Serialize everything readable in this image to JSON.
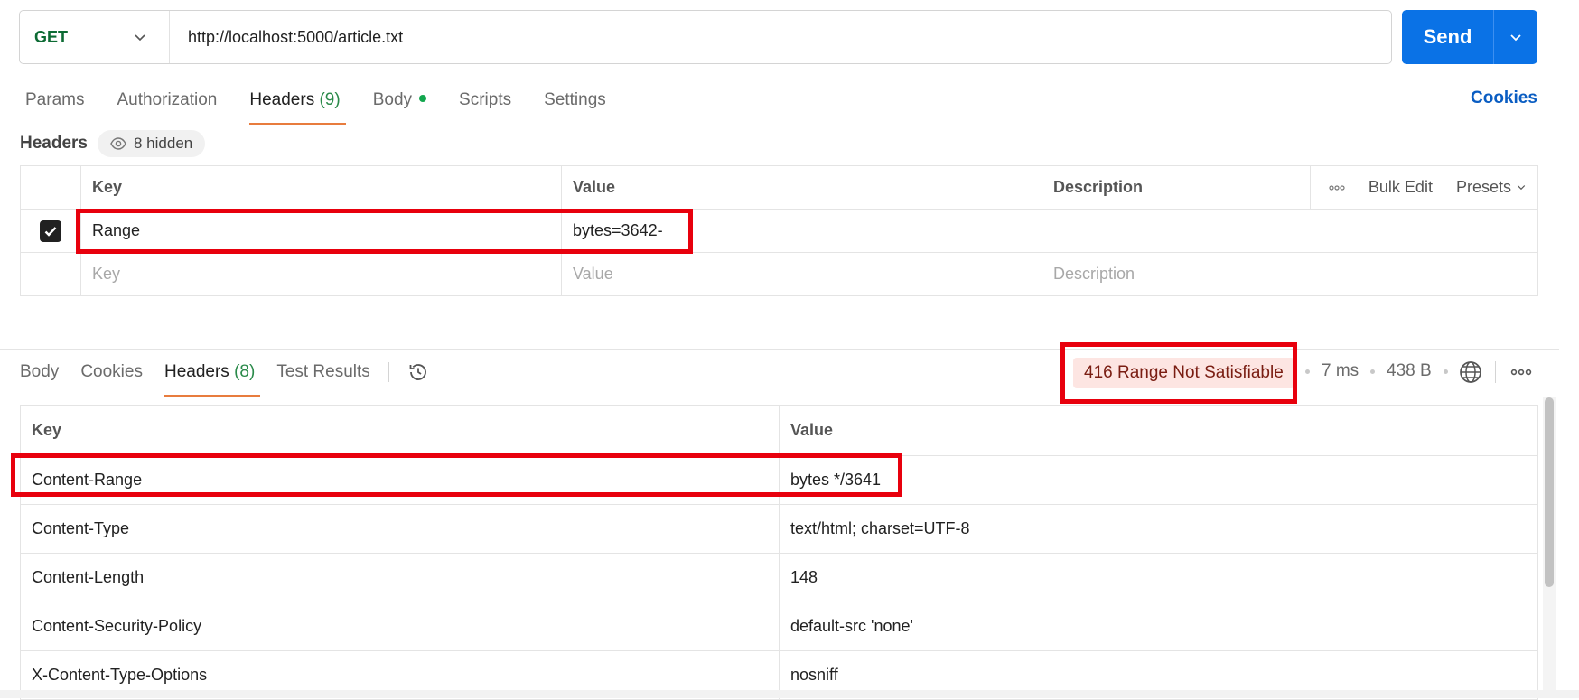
{
  "request": {
    "method": "GET",
    "url": "http://localhost:5000/article.txt",
    "send_label": "Send"
  },
  "request_tabs": [
    {
      "label": "Params"
    },
    {
      "label": "Authorization"
    },
    {
      "label": "Headers",
      "count": "(9)"
    },
    {
      "label": "Body"
    },
    {
      "label": "Scripts"
    },
    {
      "label": "Settings"
    }
  ],
  "cookies_link": "Cookies",
  "headers_section": {
    "title": "Headers",
    "hidden_label": "8 hidden"
  },
  "request_headers_table": {
    "columns": [
      "Key",
      "Value",
      "Description"
    ],
    "bulk_edit": "Bulk Edit",
    "presets": "Presets",
    "rows": [
      {
        "key": "Range",
        "value": "bytes=3642-",
        "description": "",
        "checked": true
      }
    ],
    "placeholders": {
      "key": "Key",
      "value": "Value",
      "description": "Description"
    }
  },
  "response_tabs": [
    {
      "label": "Body"
    },
    {
      "label": "Cookies"
    },
    {
      "label": "Headers",
      "count": "(8)"
    },
    {
      "label": "Test Results"
    }
  ],
  "response_meta": {
    "status": "416 Range Not Satisfiable",
    "time": "7 ms",
    "size": "438 B"
  },
  "response_headers_table": {
    "columns": [
      "Key",
      "Value"
    ],
    "rows": [
      {
        "key": "Content-Range",
        "value": "bytes */3641"
      },
      {
        "key": "Content-Type",
        "value": "text/html; charset=UTF-8"
      },
      {
        "key": "Content-Length",
        "value": "148"
      },
      {
        "key": "Content-Security-Policy",
        "value": "default-src 'none'"
      },
      {
        "key": "X-Content-Type-Options",
        "value": "nosniff"
      }
    ]
  },
  "colors": {
    "send_button": "#0a72e6",
    "method_text": "#0d6b34",
    "active_tab_underline": "#e87c3e",
    "status_pill_bg": "#fde5e2",
    "highlight_box": "#e8000d"
  }
}
